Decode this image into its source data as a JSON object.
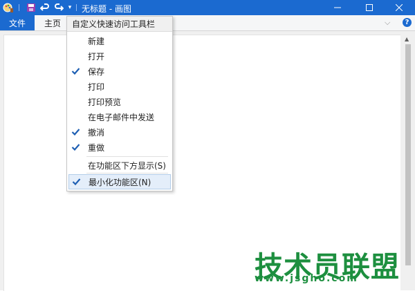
{
  "titlebar": {
    "title": "无标题 - 画图",
    "icons": [
      "paint-app-icon",
      "save-icon",
      "undo-icon",
      "redo-icon",
      "customize-qat-icon"
    ],
    "controls": [
      "minimize-icon",
      "maximize-icon",
      "close-icon"
    ],
    "accent": "#1b6ad0"
  },
  "ribbon": {
    "file_label": "文件",
    "home_label": "主页",
    "help_glyph": "?"
  },
  "qat_menu": {
    "header": "自定义快速访问工具栏",
    "items": [
      {
        "label": "新建",
        "checked": false
      },
      {
        "label": "打开",
        "checked": false
      },
      {
        "label": "保存",
        "checked": true
      },
      {
        "label": "打印",
        "checked": false
      },
      {
        "label": "打印预览",
        "checked": false
      },
      {
        "label": "在电子邮件中发送",
        "checked": false
      },
      {
        "label": "撤消",
        "checked": true
      },
      {
        "label": "重做",
        "checked": true
      },
      {
        "label": "在功能区下方显示(S)",
        "checked": false
      },
      {
        "label": "最小化功能区(N)",
        "checked": true,
        "highlighted": true
      }
    ]
  },
  "watermark": {
    "text": "技术员联盟",
    "url": "www.jsgho.com",
    "color": "#1d8f3f"
  }
}
